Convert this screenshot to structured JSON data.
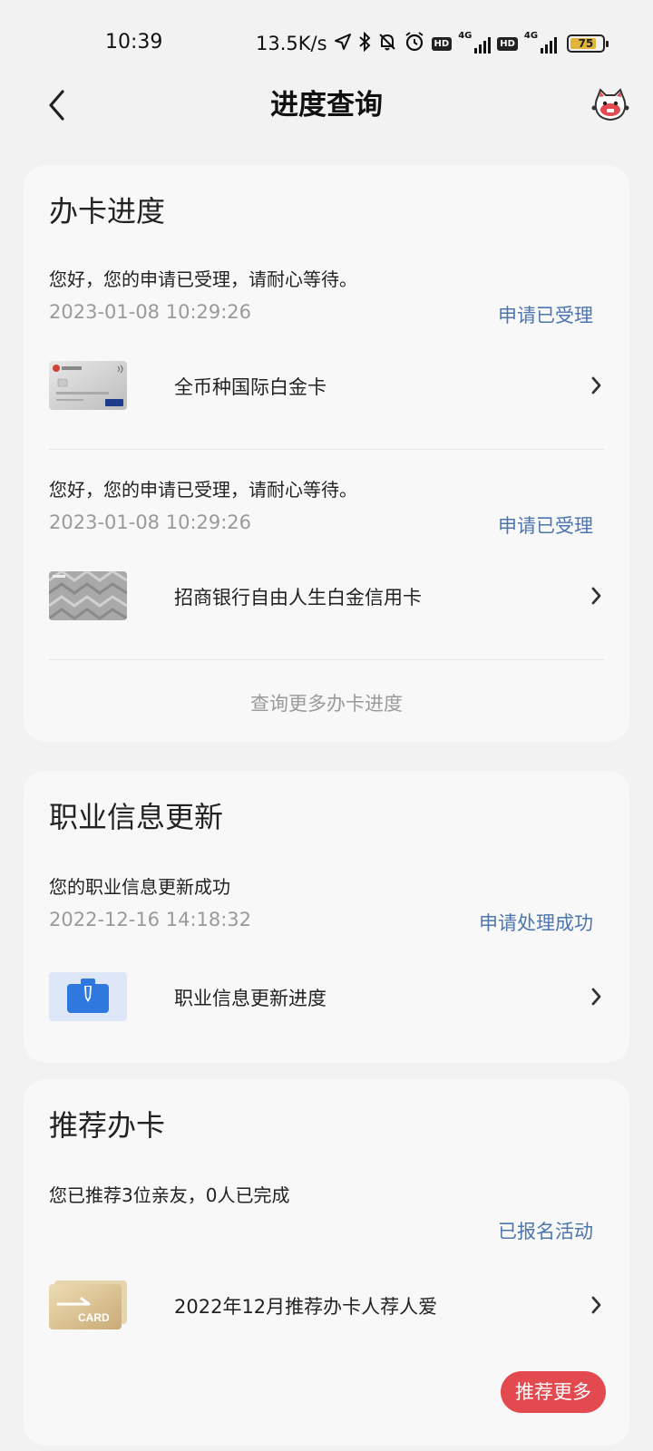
{
  "status_bar": {
    "time": "10:39",
    "net_speed": "13.5K/s",
    "hd_label": "HD",
    "network_label": "4G",
    "battery": "75",
    "icons": [
      "location-icon",
      "bluetooth-icon",
      "mute-bell-icon",
      "alarm-icon",
      "signal-icon",
      "battery-icon"
    ]
  },
  "header": {
    "title": "进度查询",
    "icons": [
      "chevron-left-icon",
      "mascot-cat-icon"
    ]
  },
  "card_progress": {
    "title": "办卡进度",
    "items": [
      {
        "message": "您好，您的申请已受理，请耐心等待。",
        "date": "2023-01-08 10:29:26",
        "status": "申请已受理",
        "card_name": "全币种国际白金卡",
        "thumb_icon": "visa-platinum-card-icon"
      },
      {
        "message": "您好，您的申请已受理，请耐心等待。",
        "date": "2023-01-08 10:29:26",
        "status": "申请已受理",
        "card_name": "招商银行自由人生白金信用卡",
        "thumb_icon": "silver-pattern-card-icon"
      }
    ],
    "more_link": "查询更多办卡进度"
  },
  "card_occupation": {
    "title": "职业信息更新",
    "message": "您的职业信息更新成功",
    "date": "2022-12-16 14:18:32",
    "status": "申请处理成功",
    "item_name": "职业信息更新进度",
    "thumb_icon": "briefcase-icon"
  },
  "card_recommend": {
    "title": "推荐办卡",
    "message": "您已推荐3位亲友，0人已完成",
    "status": "已报名活动",
    "item_name": "2022年12月推荐办卡人荐人爱",
    "thumb_icon": "gold-card-icon",
    "thumb_text": "CARD",
    "button": "推荐更多"
  },
  "colors": {
    "background": "#f2f2f2",
    "card": "#f8f8f8",
    "status_text": "#4c76ad",
    "muted_text": "#9a9a9a",
    "accent_red": "#e34a4f"
  }
}
